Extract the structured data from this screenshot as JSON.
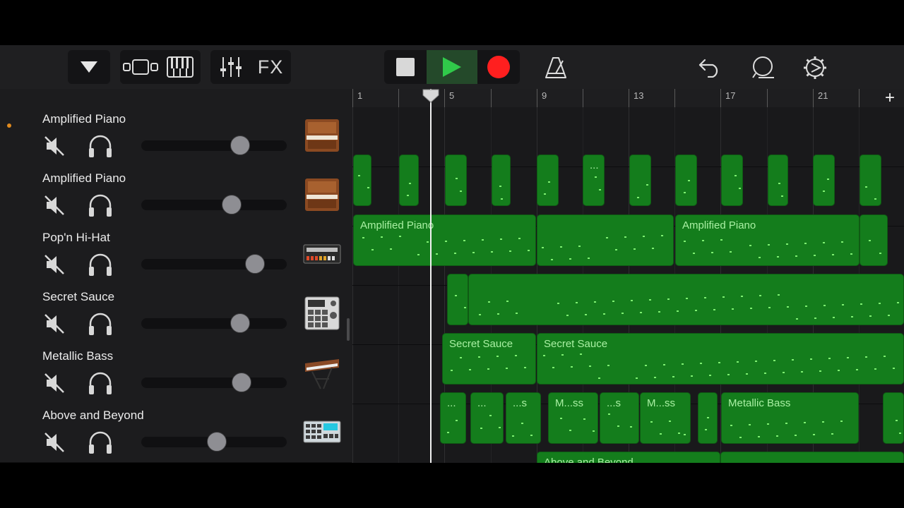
{
  "toolbar": {
    "fx_label": "FX",
    "icons": [
      "triangle-down-icon",
      "tracks-view-icon",
      "keyboard-icon",
      "mixer-icon",
      "stop-icon",
      "play-icon",
      "record-icon",
      "metronome-icon",
      "undo-icon",
      "loop-browser-icon",
      "settings-icon"
    ],
    "colors": {
      "play": "#30c94a",
      "record": "#ff1f1f",
      "region": "#147d1c",
      "note": "#7ef071"
    }
  },
  "ruler": {
    "bar_labels": [
      "1",
      "5",
      "9",
      "13",
      "17",
      "21"
    ],
    "add_label": "+"
  },
  "tracks": [
    {
      "name": "Amplified Piano",
      "volume": 0.68,
      "instrument": "upright-piano-icon",
      "selected": true
    },
    {
      "name": "Amplified Piano",
      "volume": 0.62,
      "instrument": "upright-piano-icon",
      "selected": false
    },
    {
      "name": "Pop'n Hi-Hat",
      "volume": 0.78,
      "instrument": "drum-machine-icon",
      "selected": false
    },
    {
      "name": "Secret Sauce",
      "volume": 0.68,
      "instrument": "beat-sampler-icon",
      "selected": false
    },
    {
      "name": "Metallic Bass",
      "volume": 0.69,
      "instrument": "synthesizer-icon",
      "selected": false
    },
    {
      "name": "Above and Beyond",
      "volume": 0.52,
      "instrument": "drum-pad-icon",
      "selected": false
    }
  ],
  "regions": {
    "amplified_piano_2": [
      "Amplified Piano",
      "Amplified Piano"
    ],
    "secret_sauce": [
      "Secret Sauce",
      "Secret Sauce"
    ],
    "metallic_bass": [
      "...",
      "...",
      "...s",
      "M...ss",
      "...s",
      "M...ss",
      "Metallic Bass"
    ],
    "above_and_beyond": [
      "Above and Beyond"
    ],
    "amplified_piano_1": [
      "..."
    ]
  }
}
